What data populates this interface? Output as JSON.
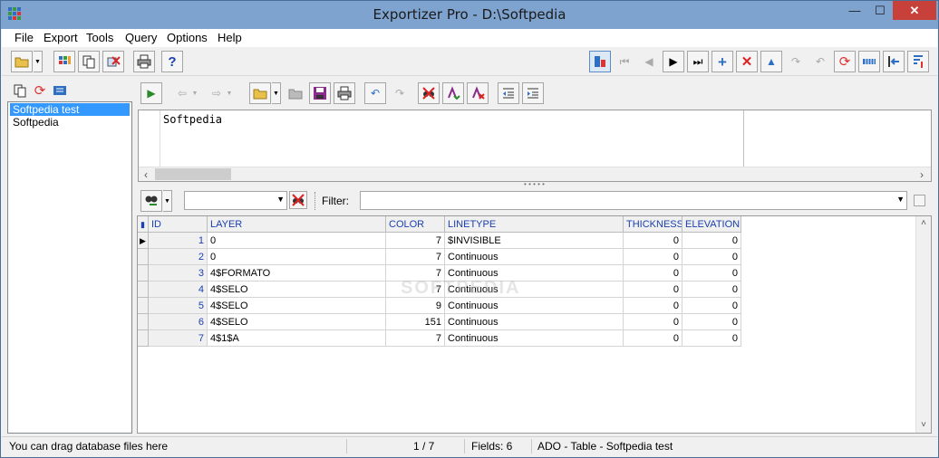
{
  "window": {
    "title": "Exportizer Pro - D:\\Softpedia",
    "minimize": "—",
    "maximize": "☐",
    "close": "✕"
  },
  "menu": {
    "items": [
      "File",
      "Export",
      "Tools",
      "Query",
      "Options",
      "Help"
    ]
  },
  "main_toolbar": {
    "left_icons": [
      "open-folder-icon",
      "dropdown-arrow-icon",
      "grid-export-icon",
      "copy-icon",
      "delete-icon",
      "print-icon",
      "help-icon"
    ],
    "right_icons": [
      "sql-icon",
      "first-record-icon",
      "prior-record-icon",
      "next-record-icon",
      "last-record-icon",
      "insert-record-icon",
      "delete-record-icon",
      "edit-record-icon",
      "post-edit-icon",
      "cancel-edit-icon",
      "refresh-icon",
      "grid-view-icon",
      "column-move-icon",
      "sort-icon"
    ],
    "help_label": "?"
  },
  "left_panel": {
    "items": [
      "Softpedia test",
      "Softpedia"
    ],
    "selected_index": 0
  },
  "sql": {
    "text": "Softpedia"
  },
  "filter": {
    "label": "Filter:",
    "field_value": "",
    "filter_value": ""
  },
  "grid": {
    "columns": [
      "ID",
      "LAYER",
      "COLOR",
      "LINETYPE",
      "THICKNESS",
      "ELEVATION"
    ],
    "rows": [
      [
        "1",
        "0",
        "7",
        "$INVISIBLE",
        "0",
        "0"
      ],
      [
        "2",
        "0",
        "7",
        "Continuous",
        "0",
        "0"
      ],
      [
        "3",
        "4$FORMATO",
        "7",
        "Continuous",
        "0",
        "0"
      ],
      [
        "4",
        "4$SELO",
        "7",
        "Continuous",
        "0",
        "0"
      ],
      [
        "5",
        "4$SELO",
        "9",
        "Continuous",
        "0",
        "0"
      ],
      [
        "6",
        "4$SELO",
        "151",
        "Continuous",
        "0",
        "0"
      ],
      [
        "7",
        "4$1$A",
        "7",
        "Continuous",
        "0",
        "0"
      ]
    ],
    "current_row": 0
  },
  "watermark": "SOFTPEDIA",
  "status": {
    "hint": "You can drag database files here",
    "position": "1 / 7",
    "fields": "Fields: 6",
    "source": "ADO - Table - Softpedia test"
  }
}
